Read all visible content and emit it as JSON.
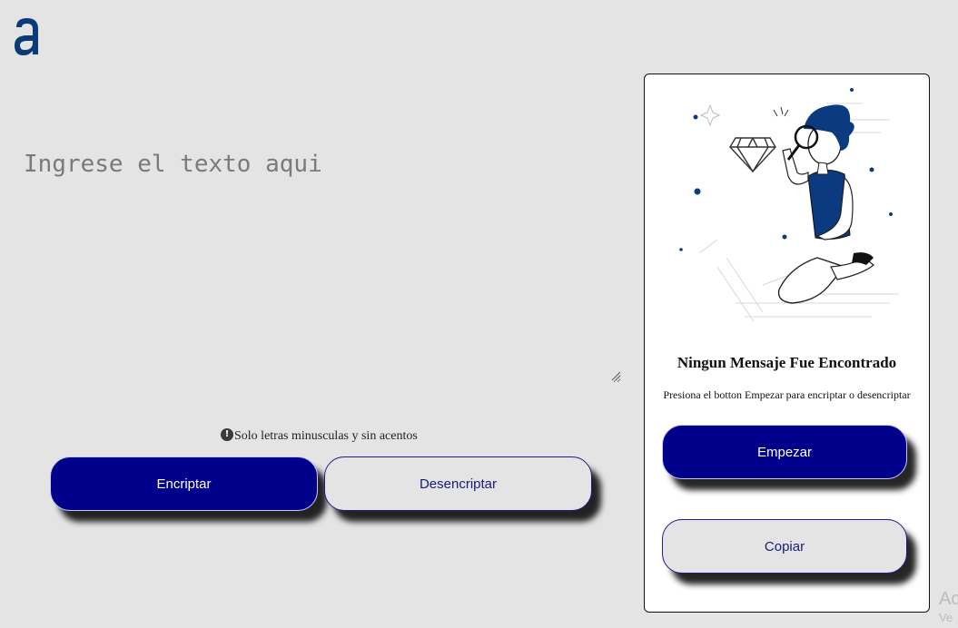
{
  "app": {
    "logo_alt": "a"
  },
  "input": {
    "placeholder": "Ingrese el texto aqui",
    "value": ""
  },
  "hint": {
    "icon": "exclamation-circle-icon",
    "text": "Solo letras minusculas y sin acentos"
  },
  "actions": {
    "encrypt_label": "Encriptar",
    "decrypt_label": "Desencriptar"
  },
  "result_panel": {
    "title": "Ningun Mensaje Fue Encontrado",
    "subtitle": "Presiona el botton Empezar para encriptar o desencriptar",
    "start_label": "Empezar",
    "copy_label": "Copiar"
  },
  "watermark": {
    "line1": "Ac",
    "line2": "Ve"
  },
  "colors": {
    "background": "#e4e4e4",
    "primary": "#00008b",
    "logo": "#0a3a78",
    "illustration_accent": "#0b3a80"
  }
}
